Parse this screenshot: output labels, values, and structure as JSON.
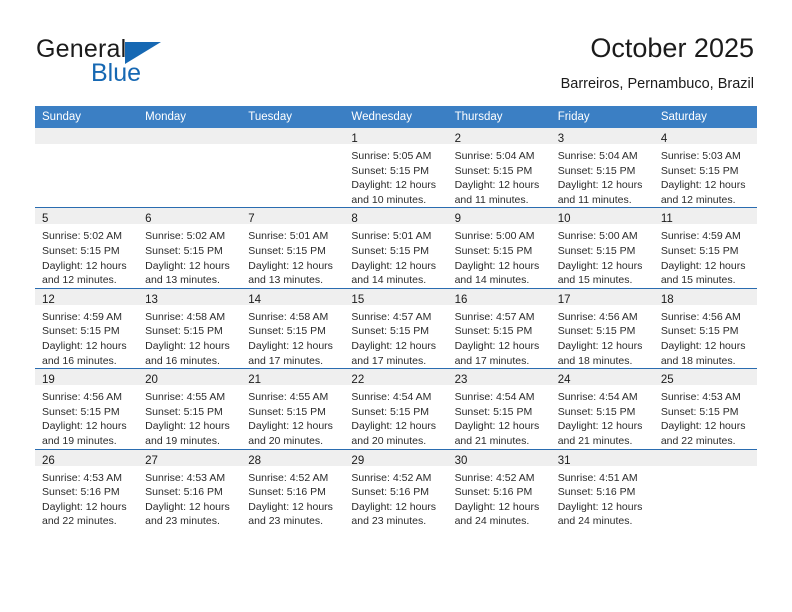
{
  "brand": {
    "name_part1": "General",
    "name_part2": "Blue",
    "logo_icon": "triangle-flag-icon",
    "color_primary": "#1668b3",
    "color_text": "#1b1b1b"
  },
  "header": {
    "title": "October 2025",
    "subtitle": "Barreiros, Pernambuco, Brazil"
  },
  "theme": {
    "header_row_bg": "#3b7fc4",
    "row_divider": "#2a6cb0",
    "daynum_band_bg": "#efefef",
    "page_bg": "#ffffff"
  },
  "weekday_headers": [
    "Sunday",
    "Monday",
    "Tuesday",
    "Wednesday",
    "Thursday",
    "Friday",
    "Saturday"
  ],
  "weeks": [
    [
      {
        "day": "",
        "empty": true
      },
      {
        "day": "",
        "empty": true
      },
      {
        "day": "",
        "empty": true
      },
      {
        "day": "1",
        "sunrise": "Sunrise: 5:05 AM",
        "sunset": "Sunset: 5:15 PM",
        "daylight_line1": "Daylight: 12 hours",
        "daylight_line2": "and 10 minutes."
      },
      {
        "day": "2",
        "sunrise": "Sunrise: 5:04 AM",
        "sunset": "Sunset: 5:15 PM",
        "daylight_line1": "Daylight: 12 hours",
        "daylight_line2": "and 11 minutes."
      },
      {
        "day": "3",
        "sunrise": "Sunrise: 5:04 AM",
        "sunset": "Sunset: 5:15 PM",
        "daylight_line1": "Daylight: 12 hours",
        "daylight_line2": "and 11 minutes."
      },
      {
        "day": "4",
        "sunrise": "Sunrise: 5:03 AM",
        "sunset": "Sunset: 5:15 PM",
        "daylight_line1": "Daylight: 12 hours",
        "daylight_line2": "and 12 minutes."
      }
    ],
    [
      {
        "day": "5",
        "sunrise": "Sunrise: 5:02 AM",
        "sunset": "Sunset: 5:15 PM",
        "daylight_line1": "Daylight: 12 hours",
        "daylight_line2": "and 12 minutes."
      },
      {
        "day": "6",
        "sunrise": "Sunrise: 5:02 AM",
        "sunset": "Sunset: 5:15 PM",
        "daylight_line1": "Daylight: 12 hours",
        "daylight_line2": "and 13 minutes."
      },
      {
        "day": "7",
        "sunrise": "Sunrise: 5:01 AM",
        "sunset": "Sunset: 5:15 PM",
        "daylight_line1": "Daylight: 12 hours",
        "daylight_line2": "and 13 minutes."
      },
      {
        "day": "8",
        "sunrise": "Sunrise: 5:01 AM",
        "sunset": "Sunset: 5:15 PM",
        "daylight_line1": "Daylight: 12 hours",
        "daylight_line2": "and 14 minutes."
      },
      {
        "day": "9",
        "sunrise": "Sunrise: 5:00 AM",
        "sunset": "Sunset: 5:15 PM",
        "daylight_line1": "Daylight: 12 hours",
        "daylight_line2": "and 14 minutes."
      },
      {
        "day": "10",
        "sunrise": "Sunrise: 5:00 AM",
        "sunset": "Sunset: 5:15 PM",
        "daylight_line1": "Daylight: 12 hours",
        "daylight_line2": "and 15 minutes."
      },
      {
        "day": "11",
        "sunrise": "Sunrise: 4:59 AM",
        "sunset": "Sunset: 5:15 PM",
        "daylight_line1": "Daylight: 12 hours",
        "daylight_line2": "and 15 minutes."
      }
    ],
    [
      {
        "day": "12",
        "sunrise": "Sunrise: 4:59 AM",
        "sunset": "Sunset: 5:15 PM",
        "daylight_line1": "Daylight: 12 hours",
        "daylight_line2": "and 16 minutes."
      },
      {
        "day": "13",
        "sunrise": "Sunrise: 4:58 AM",
        "sunset": "Sunset: 5:15 PM",
        "daylight_line1": "Daylight: 12 hours",
        "daylight_line2": "and 16 minutes."
      },
      {
        "day": "14",
        "sunrise": "Sunrise: 4:58 AM",
        "sunset": "Sunset: 5:15 PM",
        "daylight_line1": "Daylight: 12 hours",
        "daylight_line2": "and 17 minutes."
      },
      {
        "day": "15",
        "sunrise": "Sunrise: 4:57 AM",
        "sunset": "Sunset: 5:15 PM",
        "daylight_line1": "Daylight: 12 hours",
        "daylight_line2": "and 17 minutes."
      },
      {
        "day": "16",
        "sunrise": "Sunrise: 4:57 AM",
        "sunset": "Sunset: 5:15 PM",
        "daylight_line1": "Daylight: 12 hours",
        "daylight_line2": "and 17 minutes."
      },
      {
        "day": "17",
        "sunrise": "Sunrise: 4:56 AM",
        "sunset": "Sunset: 5:15 PM",
        "daylight_line1": "Daylight: 12 hours",
        "daylight_line2": "and 18 minutes."
      },
      {
        "day": "18",
        "sunrise": "Sunrise: 4:56 AM",
        "sunset": "Sunset: 5:15 PM",
        "daylight_line1": "Daylight: 12 hours",
        "daylight_line2": "and 18 minutes."
      }
    ],
    [
      {
        "day": "19",
        "sunrise": "Sunrise: 4:56 AM",
        "sunset": "Sunset: 5:15 PM",
        "daylight_line1": "Daylight: 12 hours",
        "daylight_line2": "and 19 minutes."
      },
      {
        "day": "20",
        "sunrise": "Sunrise: 4:55 AM",
        "sunset": "Sunset: 5:15 PM",
        "daylight_line1": "Daylight: 12 hours",
        "daylight_line2": "and 19 minutes."
      },
      {
        "day": "21",
        "sunrise": "Sunrise: 4:55 AM",
        "sunset": "Sunset: 5:15 PM",
        "daylight_line1": "Daylight: 12 hours",
        "daylight_line2": "and 20 minutes."
      },
      {
        "day": "22",
        "sunrise": "Sunrise: 4:54 AM",
        "sunset": "Sunset: 5:15 PM",
        "daylight_line1": "Daylight: 12 hours",
        "daylight_line2": "and 20 minutes."
      },
      {
        "day": "23",
        "sunrise": "Sunrise: 4:54 AM",
        "sunset": "Sunset: 5:15 PM",
        "daylight_line1": "Daylight: 12 hours",
        "daylight_line2": "and 21 minutes."
      },
      {
        "day": "24",
        "sunrise": "Sunrise: 4:54 AM",
        "sunset": "Sunset: 5:15 PM",
        "daylight_line1": "Daylight: 12 hours",
        "daylight_line2": "and 21 minutes."
      },
      {
        "day": "25",
        "sunrise": "Sunrise: 4:53 AM",
        "sunset": "Sunset: 5:15 PM",
        "daylight_line1": "Daylight: 12 hours",
        "daylight_line2": "and 22 minutes."
      }
    ],
    [
      {
        "day": "26",
        "sunrise": "Sunrise: 4:53 AM",
        "sunset": "Sunset: 5:16 PM",
        "daylight_line1": "Daylight: 12 hours",
        "daylight_line2": "and 22 minutes."
      },
      {
        "day": "27",
        "sunrise": "Sunrise: 4:53 AM",
        "sunset": "Sunset: 5:16 PM",
        "daylight_line1": "Daylight: 12 hours",
        "daylight_line2": "and 23 minutes."
      },
      {
        "day": "28",
        "sunrise": "Sunrise: 4:52 AM",
        "sunset": "Sunset: 5:16 PM",
        "daylight_line1": "Daylight: 12 hours",
        "daylight_line2": "and 23 minutes."
      },
      {
        "day": "29",
        "sunrise": "Sunrise: 4:52 AM",
        "sunset": "Sunset: 5:16 PM",
        "daylight_line1": "Daylight: 12 hours",
        "daylight_line2": "and 23 minutes."
      },
      {
        "day": "30",
        "sunrise": "Sunrise: 4:52 AM",
        "sunset": "Sunset: 5:16 PM",
        "daylight_line1": "Daylight: 12 hours",
        "daylight_line2": "and 24 minutes."
      },
      {
        "day": "31",
        "sunrise": "Sunrise: 4:51 AM",
        "sunset": "Sunset: 5:16 PM",
        "daylight_line1": "Daylight: 12 hours",
        "daylight_line2": "and 24 minutes."
      },
      {
        "day": "",
        "empty": true
      }
    ]
  ]
}
